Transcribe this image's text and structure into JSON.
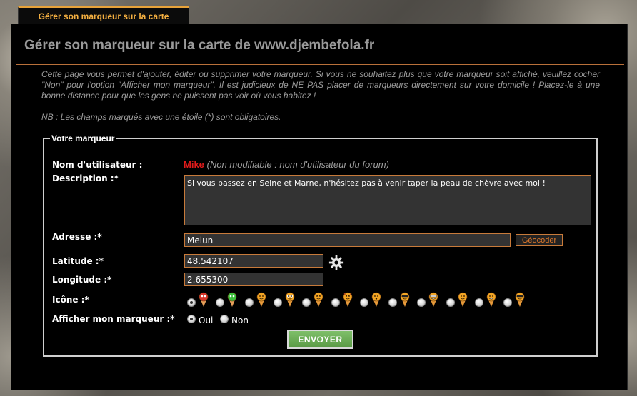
{
  "tab": {
    "label": "Gérer son marqueur sur la carte"
  },
  "page_title": "Gérer son marqueur sur la carte de www.djembefola.fr",
  "intro_text": "Cette page vous permet d'ajouter, éditer ou supprimer votre marqueur. Si vous ne souhaitez plus que votre marqueur soit affiché, veuillez cocher \"Non\" pour l'option \"Afficher mon marqueur\". Il est judicieux de NE PAS placer de marqueurs directement sur votre domicile ! Placez-le à une bonne distance pour que les gens ne puissent pas voir où vous habitez !",
  "note_text": "NB : Les champs marqués avec une étoile (*) sont obligatoires.",
  "form": {
    "legend": "Votre marqueur",
    "username_label": "Nom d'utilisateur :",
    "username_value": "Mike",
    "username_hint": "(Non modifiable : nom d'utilisateur du forum)",
    "description_label": "Description :*",
    "description_value": "Si vous passez en Seine et Marne, n'hésitez pas à venir taper la peau de chèvre avec moi !",
    "address_label": "Adresse :*",
    "address_value": "Melun",
    "geocode_label": "Géocoder",
    "latitude_label": "Latitude :*",
    "latitude_value": "48.542107",
    "longitude_label": "Longitude :*",
    "longitude_value": "2.655300",
    "icon_label": "Icône :*",
    "show_label": "Afficher mon marqueur :*",
    "show_yes": "Oui",
    "show_no": "Non",
    "submit_label": "ENVOYER"
  },
  "icons": [
    "red-marker-icon",
    "green-marker-icon",
    "smile-marker-icon",
    "eyes-marker-icon",
    "angry-marker-icon",
    "devil-marker-icon",
    "surprised-marker-icon",
    "sunglasses-marker-icon",
    "nerd-marker-icon",
    "wink-marker-icon",
    "grin-marker-icon",
    "cool-marker-icon"
  ],
  "colors": {
    "accent": "#e8a33a",
    "field_border": "#c77a3a",
    "username": "#e01b1b",
    "submit": "#6fb05a"
  }
}
